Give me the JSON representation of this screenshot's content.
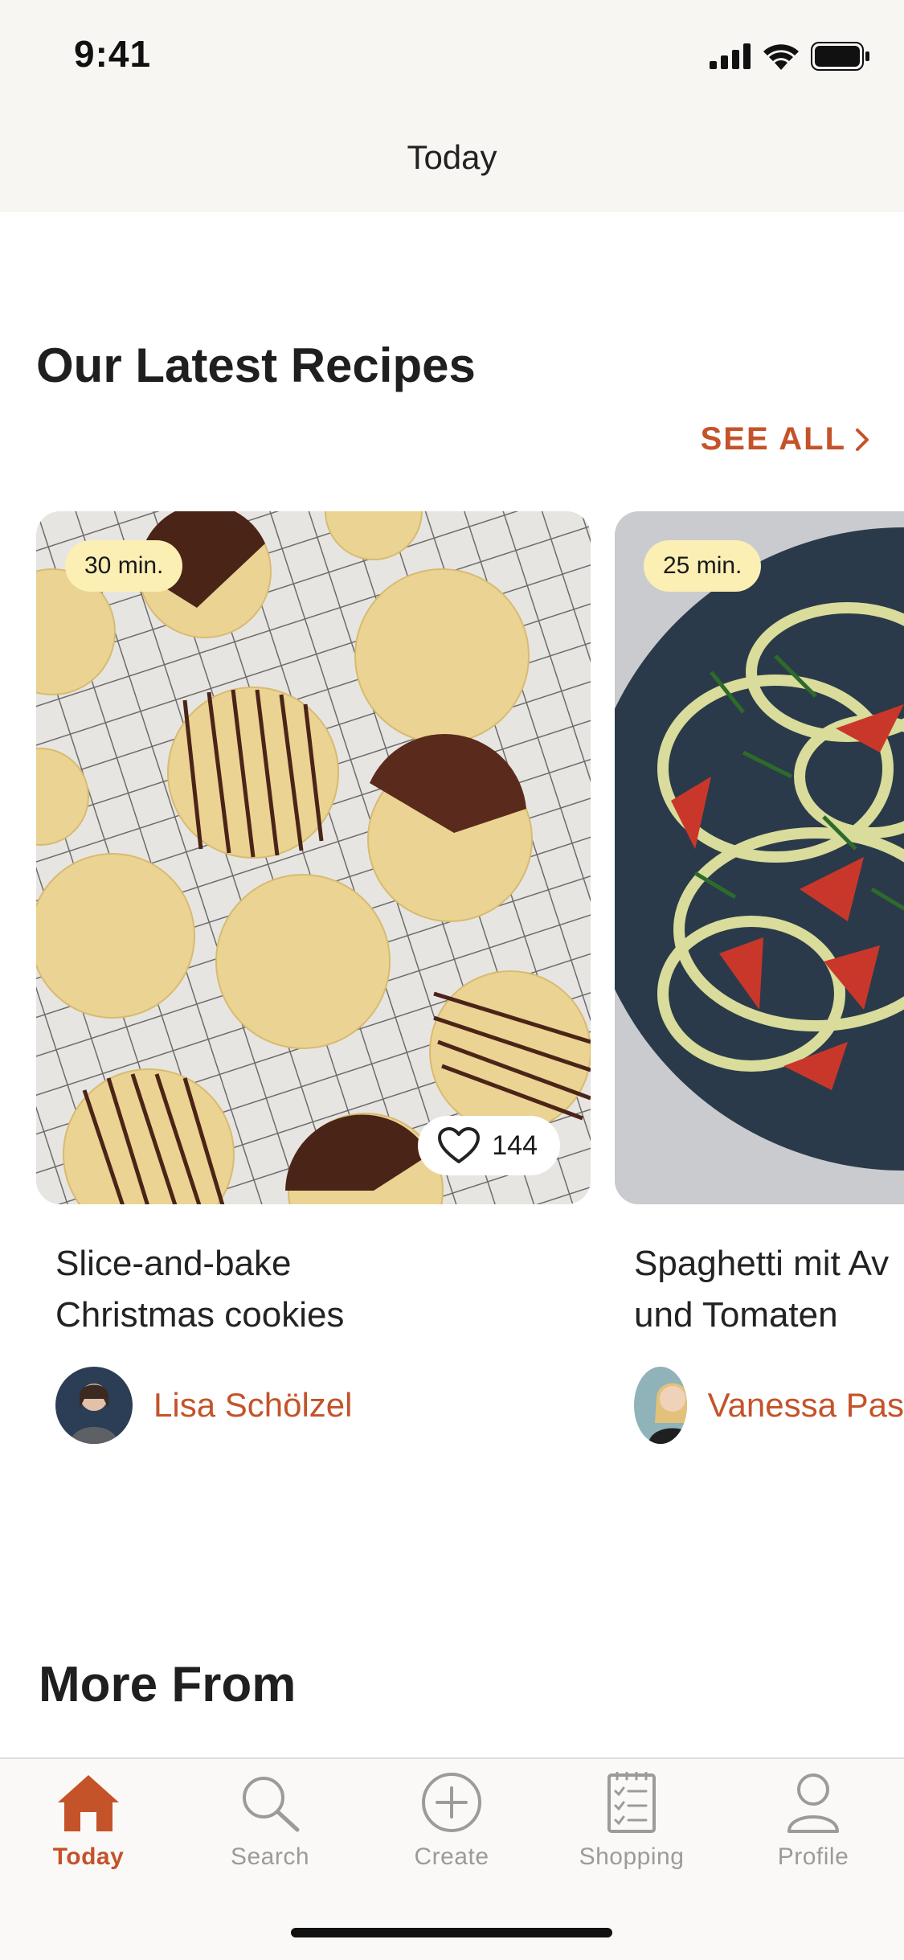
{
  "status_bar": {
    "time": "9:41"
  },
  "header": {
    "title": "Today"
  },
  "section": {
    "title": "Our Latest Recipes",
    "see_all_label": "SEE ALL"
  },
  "recipes": [
    {
      "duration": "30 min.",
      "likes": "144",
      "title_line1": "Slice-and-bake",
      "title_line2": "Christmas cookies",
      "author": "Lisa Schölzel",
      "image": "cookies-on-cooling-rack"
    },
    {
      "duration": "25 min.",
      "title_line1": "Spaghetti mit Av",
      "title_line2": "und Tomaten",
      "author": "Vanessa Pas",
      "image": "spaghetti-with-tomatoes"
    }
  ],
  "more_from": {
    "title": "More From"
  },
  "tab_bar": {
    "items": [
      {
        "label": "Today",
        "icon": "home-icon",
        "active": true
      },
      {
        "label": "Search",
        "icon": "search-icon",
        "active": false
      },
      {
        "label": "Create",
        "icon": "plus-circle-icon",
        "active": false
      },
      {
        "label": "Shopping",
        "icon": "checklist-icon",
        "active": false
      },
      {
        "label": "Profile",
        "icon": "person-icon",
        "active": false
      }
    ]
  },
  "colors": {
    "accent": "#c4532a",
    "badge": "#fcefb4",
    "header_bg": "#f8f6f3"
  }
}
